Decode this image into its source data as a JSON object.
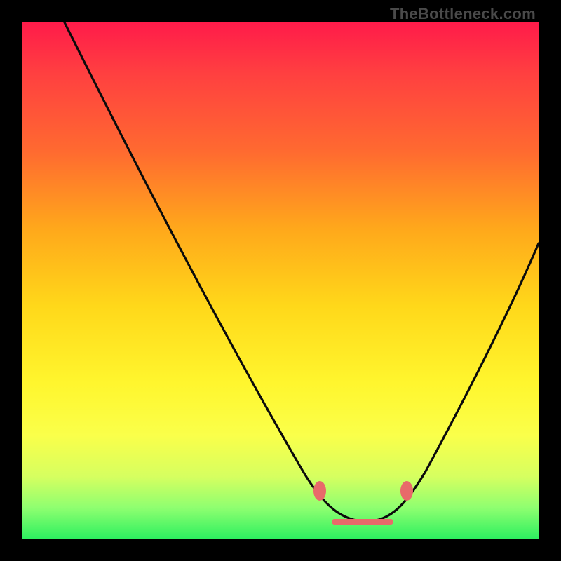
{
  "watermark": "TheBottleneck.com",
  "colors": {
    "black": "#000000",
    "curve": "#0b0b0b",
    "marker": "#e86a6a",
    "gradient_top": "#ff1b4a",
    "gradient_bottom": "#2ef060"
  },
  "chart_data": {
    "type": "line",
    "title": "",
    "xlabel": "",
    "ylabel": "",
    "xlim": [
      0,
      100
    ],
    "ylim": [
      0,
      100
    ],
    "x": [
      8,
      15,
      25,
      35,
      45,
      55,
      57,
      60,
      65,
      70,
      73,
      75,
      80,
      88,
      95,
      100
    ],
    "values": [
      100,
      88,
      72,
      56,
      40,
      24,
      20,
      14,
      7,
      3,
      3,
      4,
      10,
      28,
      46,
      58
    ],
    "annotations": [
      {
        "kind": "marker",
        "x": 57,
        "y": 11
      },
      {
        "kind": "marker",
        "x": 73,
        "y": 11
      },
      {
        "kind": "flat-range",
        "x0": 60,
        "x1": 70,
        "y": 4
      }
    ],
    "notes": "Background is a vertical spectral gradient from red (top) through yellow to green (bottom). Curve outlines a V with rounded bottom, minimum near x≈66. Pink markers sit at the two ends of the flat bottom and a short pink bar runs along the bottom between them."
  }
}
